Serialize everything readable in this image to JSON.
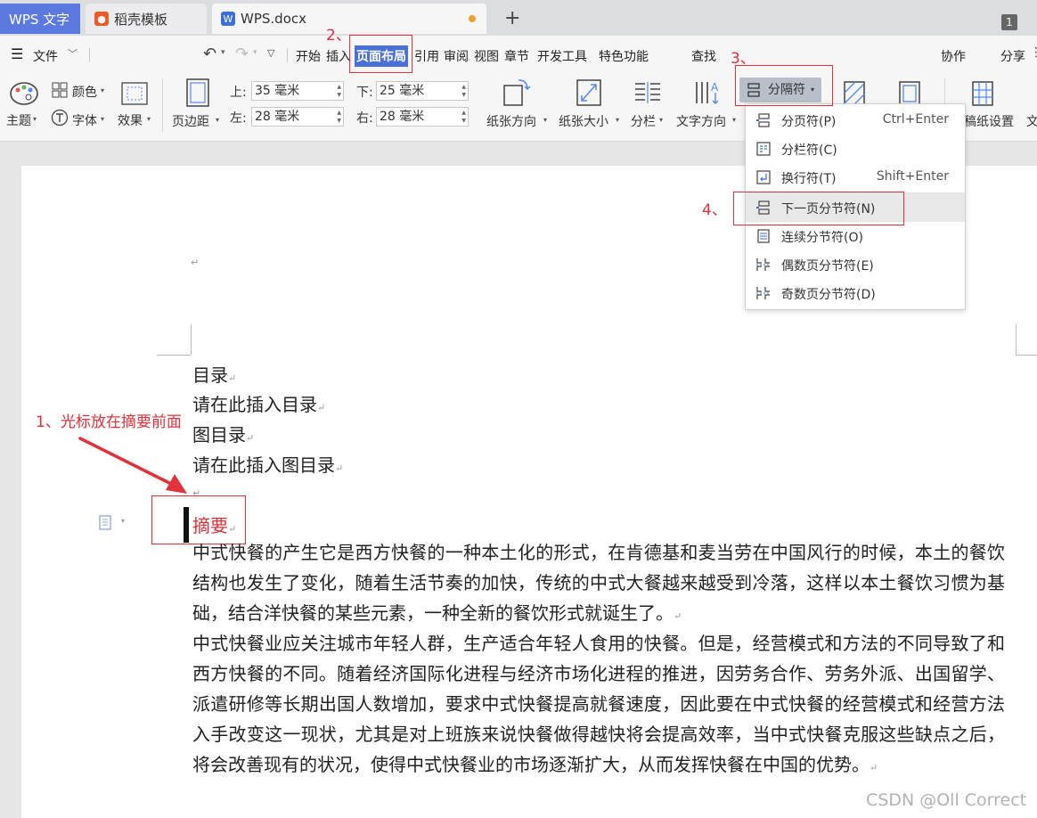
{
  "tabs": [
    {
      "label": "WPS 文字"
    },
    {
      "label": "稻壳模板"
    },
    {
      "label": "WPS.docx"
    }
  ],
  "tab_count": "1",
  "menu": {
    "file": "文件",
    "items": [
      "开始",
      "插入",
      "页面布局",
      "引用",
      "审阅",
      "视图",
      "章节",
      "开发工具",
      "特色功能"
    ],
    "search": "查找",
    "collab": "协作",
    "share": "分享"
  },
  "ribbon": {
    "theme": "主题",
    "color": "颜色",
    "font": "字体",
    "effect": "效果",
    "margins": "页边距",
    "top_label": "上:",
    "top_value": "35 毫米",
    "bottom_label": "下:",
    "bottom_value": "25 毫米",
    "left_label": "左:",
    "left_value": "28 毫米",
    "right_label": "右:",
    "right_value": "28 毫米",
    "orientation": "纸张方向",
    "size": "纸张大小",
    "columns": "分栏",
    "text_direction": "文字方向",
    "separator": "分隔符",
    "paper_setup": "稿纸设置",
    "cut_text": "文"
  },
  "dropdown": [
    {
      "label": "分页符(P)",
      "shortcut": "Ctrl+Enter"
    },
    {
      "label": "分栏符(C)",
      "shortcut": ""
    },
    {
      "label": "换行符(T)",
      "shortcut": "Shift+Enter"
    },
    {
      "label": "下一页分节符(N)",
      "shortcut": ""
    },
    {
      "label": "连续分节符(O)",
      "shortcut": ""
    },
    {
      "label": "偶数页分节符(E)",
      "shortcut": ""
    },
    {
      "label": "奇数页分节符(D)",
      "shortcut": ""
    }
  ],
  "document": {
    "toc_title": "目录",
    "toc_placeholder": "请在此插入目录",
    "fig_title": "图目录",
    "fig_placeholder": "请在此插入图目录",
    "abstract_title": "摘要",
    "para1": "中式快餐的产生它是西方快餐的一种本土化的形式，在肯德基和麦当劳在中国风行的时候，本土的餐饮结构也发生了变化，随着生活节奏的加快，传统的中式大餐越来越受到冷落，这样以本土餐饮习惯为基础，结合洋快餐的某些元素，一种全新的餐饮形式就诞生了。",
    "para2": "中式快餐业应关注城市年轻人群，生产适合年轻人食用的快餐。但是，经营模式和方法的不同导致了和西方快餐的不同。随着经济国际化进程与经济市场化进程的推进，因劳务合作、劳务外派、出国留学、派遣研修等长期出国人数增加，要求中式快餐提高就餐速度，因此要在中式快餐的经营模式和经营方法入手改变这一现状，尤其是对上班族来说快餐做得越快将会提高效率，当中式快餐克服这些缺点之后，将会改善现有的状况，使得中式快餐业的市场逐渐扩大，从而发挥快餐在中国的优势。"
  },
  "annotations": {
    "step1": "1、光标放在摘要前面",
    "step2": "2、",
    "step3": "3、",
    "step4": "4、"
  },
  "watermark": "CSDN @Oll Correct",
  "colors": {
    "accent": "#4a6fd6",
    "annotation": "#e0323a",
    "selected_menu_bg": "#b8bfc9"
  }
}
